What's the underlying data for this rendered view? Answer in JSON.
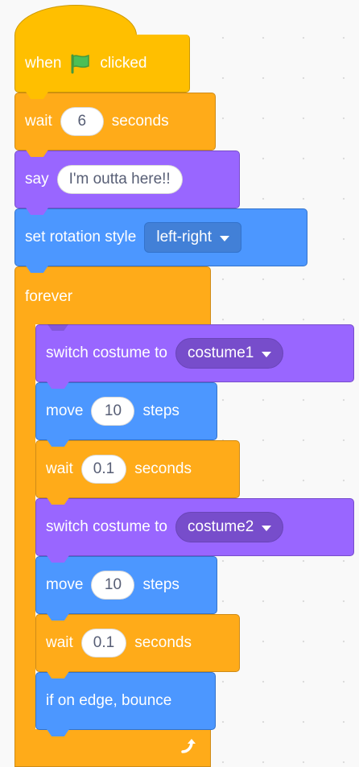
{
  "colors": {
    "events": "#ffbf00",
    "control": "#ffab19",
    "looks": "#9966ff",
    "motion": "#4c97ff",
    "flag": "#4cbf56"
  },
  "blocks": {
    "when_flag": {
      "prefix": "when",
      "icon": "green-flag-icon",
      "suffix": "clicked"
    },
    "wait_6": {
      "label": "wait",
      "value": "6",
      "unit": "seconds"
    },
    "say": {
      "label": "say",
      "value": "I'm outta here!!"
    },
    "rotation": {
      "label": "set rotation style",
      "value": "left-right"
    },
    "forever": {
      "label": "forever",
      "icon": "loop-arrow-icon"
    },
    "costume1": {
      "label": "switch costume to",
      "value": "costume1"
    },
    "move1": {
      "label": "move",
      "value": "10",
      "unit": "steps"
    },
    "wait1": {
      "label": "wait",
      "value": "0.1",
      "unit": "seconds"
    },
    "costume2": {
      "label": "switch costume to",
      "value": "costume2"
    },
    "move2": {
      "label": "move",
      "value": "10",
      "unit": "steps"
    },
    "wait2": {
      "label": "wait",
      "value": "0.1",
      "unit": "seconds"
    },
    "bounce": {
      "label": "if on edge, bounce"
    }
  }
}
